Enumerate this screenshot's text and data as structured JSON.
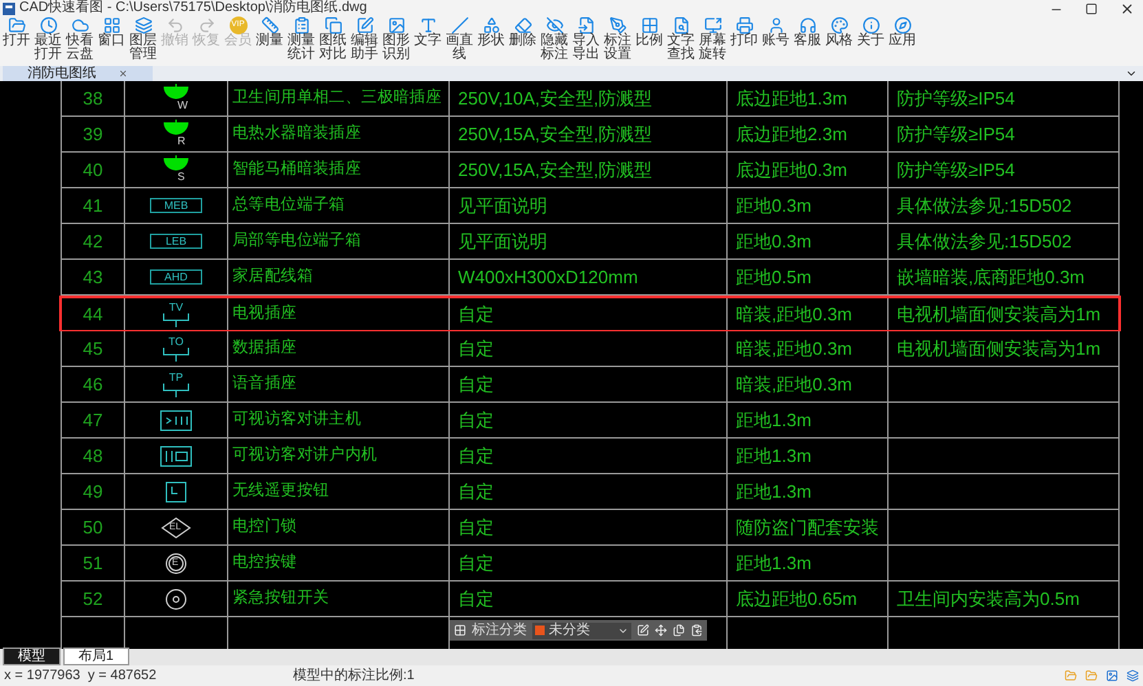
{
  "window": {
    "title": "CAD快速看图 - C:\\Users\\75175\\Desktop\\消防电图纸.dwg"
  },
  "toolbar": [
    {
      "label": "打开",
      "disabled": false
    },
    {
      "label": "最近打开",
      "disabled": false
    },
    {
      "label": "快看云盘",
      "disabled": false
    },
    {
      "label": "窗口",
      "disabled": false
    },
    {
      "label": "图层管理",
      "disabled": false
    },
    {
      "label": "撤销",
      "disabled": true
    },
    {
      "label": "恢复",
      "disabled": true
    },
    {
      "label": "会员",
      "disabled": true,
      "badge": "VIP"
    },
    {
      "label": "测量",
      "disabled": false
    },
    {
      "label": "测量统计",
      "disabled": false
    },
    {
      "label": "图纸对比",
      "disabled": false
    },
    {
      "label": "编辑助手",
      "disabled": false
    },
    {
      "label": "图形识别",
      "disabled": false
    },
    {
      "label": "文字",
      "disabled": false
    },
    {
      "label": "画直线",
      "disabled": false
    },
    {
      "label": "形状",
      "disabled": false
    },
    {
      "label": "删除",
      "disabled": false
    },
    {
      "label": "隐藏标注",
      "disabled": false
    },
    {
      "label": "导入导出",
      "disabled": false
    },
    {
      "label": "标注设置",
      "disabled": false
    },
    {
      "label": "比例",
      "disabled": false
    },
    {
      "label": "文字查找",
      "disabled": false
    },
    {
      "label": "屏幕旋转",
      "disabled": false
    },
    {
      "label": "打印",
      "disabled": false
    },
    {
      "label": "账号",
      "disabled": false
    },
    {
      "label": "客服",
      "disabled": false
    },
    {
      "label": "风格",
      "disabled": false
    },
    {
      "label": "关于",
      "disabled": false
    },
    {
      "label": "应用",
      "disabled": false
    }
  ],
  "document_tabs": [
    {
      "label": "消防电图纸",
      "selected": true
    }
  ],
  "table": {
    "rows": [
      {
        "no": "38",
        "symbol": {
          "kind": "socket",
          "label": "W"
        },
        "name": "卫生间用单相二、三极暗插座",
        "spec": "250V,10A,安全型,防溅型",
        "install": "底边距地1.3m",
        "remark": "防护等级≥IP54",
        "selected": false
      },
      {
        "no": "39",
        "symbol": {
          "kind": "socket",
          "label": "R"
        },
        "name": "电热水器暗装插座",
        "spec": "250V,15A,安全型,防溅型",
        "install": "底边距地2.3m",
        "remark": "防护等级≥IP54",
        "selected": false
      },
      {
        "no": "40",
        "symbol": {
          "kind": "socket",
          "label": "S"
        },
        "name": "智能马桶暗装插座",
        "spec": "250V,15A,安全型,防溅型",
        "install": "底边距地0.3m",
        "remark": "防护等级≥IP54",
        "selected": false
      },
      {
        "no": "41",
        "symbol": {
          "kind": "box",
          "label": "MEB"
        },
        "name": "总等电位端子箱",
        "spec": "见平面说明",
        "install": "距地0.3m",
        "remark": "具体做法参见:15D502",
        "selected": false
      },
      {
        "no": "42",
        "symbol": {
          "kind": "box",
          "label": "LEB"
        },
        "name": "局部等电位端子箱",
        "spec": "见平面说明",
        "install": "距地0.3m",
        "remark": "具体做法参见:15D502",
        "selected": false
      },
      {
        "no": "43",
        "symbol": {
          "kind": "box",
          "label": "AHD"
        },
        "name": "家居配线箱",
        "spec": "W400xH300xD120mm",
        "install": "距地0.5m",
        "remark": "嵌墙暗装,底商距地0.3m",
        "selected": false
      },
      {
        "no": "44",
        "symbol": {
          "kind": "outlet",
          "label": "TV"
        },
        "name": "电视插座",
        "spec": "自定",
        "install": "暗装,距地0.3m",
        "remark": "电视机墙面侧安装高为1m",
        "selected": true
      },
      {
        "no": "45",
        "symbol": {
          "kind": "outlet",
          "label": "TO"
        },
        "name": "数据插座",
        "spec": "自定",
        "install": "暗装,距地0.3m",
        "remark": "电视机墙面侧安装高为1m",
        "selected": false
      },
      {
        "no": "46",
        "symbol": {
          "kind": "outlet",
          "label": "TP"
        },
        "name": "语音插座",
        "spec": "自定",
        "install": "暗装,距地0.3m",
        "selected": false
      },
      {
        "no": "47",
        "symbol": {
          "kind": "intercom"
        },
        "name": "可视访客对讲主机",
        "spec": "自定",
        "install": "距地1.3m",
        "selected": false
      },
      {
        "no": "48",
        "symbol": {
          "kind": "indoor"
        },
        "name": "可视访客对讲户内机",
        "spec": "自定",
        "install": "距地1.3m",
        "selected": false
      },
      {
        "no": "49",
        "symbol": {
          "kind": "button"
        },
        "name": "无线遥更按钮",
        "spec": "自定",
        "install": "距地1.3m",
        "selected": false
      },
      {
        "no": "50",
        "symbol": {
          "kind": "lock",
          "label": "EL"
        },
        "name": "电控门锁",
        "spec": "自定",
        "install": "随防盗门配套安装",
        "selected": false
      },
      {
        "no": "51",
        "symbol": {
          "kind": "circle",
          "label": "E"
        },
        "name": "电控按键",
        "spec": "自定",
        "install": "距地1.3m",
        "selected": false
      },
      {
        "no": "52",
        "symbol": {
          "kind": "ring"
        },
        "name": "紧急按钮开关",
        "spec": "自定",
        "install": "底边距地0.65m",
        "remark": "卫生间内安装高为0.5m",
        "selected": false
      }
    ]
  },
  "floating_toolbar": {
    "label": "标注分类",
    "category": "未分类"
  },
  "layout_tabs": [
    {
      "label": "模型",
      "selected": true
    },
    {
      "label": "布局1",
      "selected": false
    }
  ],
  "status_bar": {
    "coords": "x = 1977963  y = 487652",
    "scale": "模型中的标注比例:1"
  }
}
